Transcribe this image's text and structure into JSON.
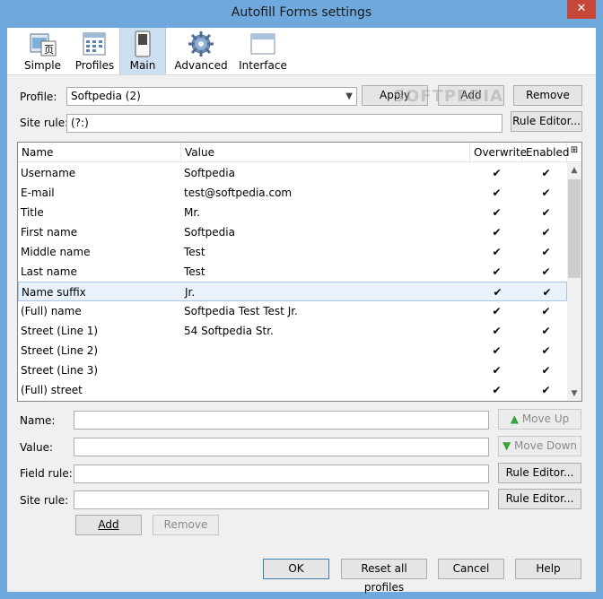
{
  "window": {
    "title": "Autofill Forms settings",
    "close_glyph": "✕"
  },
  "toolbar": {
    "items": [
      {
        "label": "Simple",
        "icon": "simple-form-icon"
      },
      {
        "label": "Profiles",
        "icon": "profiles-icon"
      },
      {
        "label": "Main",
        "icon": "main-toggle-icon",
        "active": true
      },
      {
        "label": "Advanced",
        "icon": "gear-icon"
      },
      {
        "label": "Interface",
        "icon": "window-icon"
      }
    ]
  },
  "profile": {
    "label": "Profile:",
    "selected": "Softpedia (2)",
    "apply_label": "Apply",
    "add_label": "Add",
    "remove_label": "Remove"
  },
  "site_rule_top": {
    "label": "Site rule:",
    "value": "(?:)",
    "rule_editor_label": "Rule Editor..."
  },
  "watermark": "SOFTPEDIA",
  "grid": {
    "columns": [
      "Name",
      "Value",
      "Overwrite",
      "Enabled"
    ],
    "rows": [
      {
        "name": "Username",
        "value": "Softpedia",
        "overwrite": "✔",
        "enabled": "✔"
      },
      {
        "name": "E-mail",
        "value": "test@softpedia.com",
        "overwrite": "✔",
        "enabled": "✔"
      },
      {
        "name": "Title",
        "value": "Mr.",
        "overwrite": "✔",
        "enabled": "✔"
      },
      {
        "name": "First name",
        "value": "Softpedia",
        "overwrite": "✔",
        "enabled": "✔"
      },
      {
        "name": "Middle name",
        "value": "Test",
        "overwrite": "✔",
        "enabled": "✔"
      },
      {
        "name": "Last name",
        "value": "Test",
        "overwrite": "✔",
        "enabled": "✔"
      },
      {
        "name": "Name suffix",
        "value": "Jr.",
        "overwrite": "✔",
        "enabled": "✔",
        "selected": true
      },
      {
        "name": "(Full) name",
        "value": "Softpedia Test Test Jr.",
        "overwrite": "✔",
        "enabled": "✔"
      },
      {
        "name": "Street (Line 1)",
        "value": "54 Softpedia Str.",
        "overwrite": "✔",
        "enabled": "✔"
      },
      {
        "name": "Street (Line 2)",
        "value": "",
        "overwrite": "✔",
        "enabled": "✔"
      },
      {
        "name": "Street (Line 3)",
        "value": "",
        "overwrite": "✔",
        "enabled": "✔"
      },
      {
        "name": "(Full) street",
        "value": "",
        "overwrite": "✔",
        "enabled": "✔"
      }
    ]
  },
  "editor": {
    "name_label": "Name:",
    "value_label": "Value:",
    "field_rule_label": "Field rule:",
    "site_rule_label": "Site rule:",
    "move_up_label": "Move Up",
    "move_down_label": "Move Down",
    "rule_editor_label": "Rule Editor...",
    "add_label": "Add",
    "remove_label": "Remove"
  },
  "footer": {
    "ok_label": "OK",
    "reset_label": "Reset all profiles",
    "cancel_label": "Cancel",
    "help_label": "Help"
  }
}
